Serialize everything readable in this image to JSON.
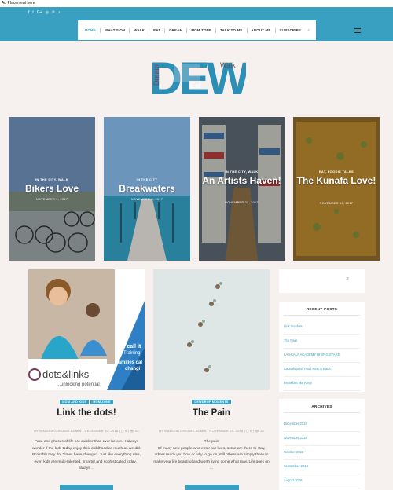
{
  "ad": {
    "text": "Ad Placement here"
  },
  "social_icons": [
    "facebook-icon",
    "twitter-icon",
    "google-plus-icon",
    "instagram-icon",
    "pinterest-icon",
    "blog-icon"
  ],
  "social_glyphs": [
    "f",
    "t",
    "G+",
    "◎",
    "℗",
    "♁"
  ],
  "nav": {
    "items": [
      "HOME",
      "WHAT'S ON",
      "WALK",
      "EAT",
      "DREAM",
      "MOM ZONE",
      "TALK TO ME",
      "ABOUT ME",
      "SUBSCRIBE"
    ],
    "search_glyph": "⌕"
  },
  "logo": {
    "big": "DEW",
    "dream": "Dream",
    "eat": "Eat",
    "walk": "Walk"
  },
  "featured": [
    {
      "category": "IN THE CITY, WALK",
      "title": "Bikers Love",
      "date": "NOVEMBER 9, 2017"
    },
    {
      "category": "IN THE CITY",
      "title": "Breakwaters",
      "date": "NOVEMBER 8, 2017"
    },
    {
      "category": "IN THE CITY, WALK",
      "title": "An Artists Haven!",
      "date": "NOVEMBER 21, 2017"
    },
    {
      "category": "EAT, FOODIE TALKS",
      "title": "The Kunafa Love!",
      "date": "NOVEMBER 13, 2017"
    }
  ],
  "posts": [
    {
      "tags": [
        "MOM AND KIDS",
        "MOM ZONE"
      ],
      "title": "Link the dots!",
      "meta": "BY WALKEATDREAMS ADMIN  |  DECEMBER 10, 2018  |  ◻ 0  |  👁 43",
      "excerpt": "Pace and phases of life are quicker than ever before.. I always wonder if the kids today enjoy their childhood as much as we did. Probably they do. Times have changed. Just like everything else, even kids are multi-talented, smarter and sophisticated today. I always ...",
      "image_text": {
        "callout1": "We call it",
        "callout2": "Training",
        "callout3": "Families cal",
        "callout4": "changi",
        "brand": "dots&links",
        "tagline": "...unlocking potential"
      }
    },
    {
      "tags": [
        "DEWDROP MOMENTS"
      ],
      "title": "The Pain",
      "meta": "BY WALKEATDREAMS ADMIN  |  NOVEMBER 25, 2018  |  ◻ 0  |  👁 18",
      "excerpt_lead": "The pain",
      "excerpt": "Of many new people who enter our lives, some are there to stay, others teach you how or why to go on, still others are simply there to make your life beautiful and worth living come what may. Life goes on ..."
    }
  ],
  "sidebar": {
    "search_glyph": "⌕",
    "recent_title": "RECENT POSTS",
    "recent": [
      "Link the dots!",
      "The Pain",
      "LA SCALA ACADEMY RISING STARS",
      "Capitals Best Food Fest is Back!",
      "Breakfast like King!"
    ],
    "archives_title": "ARCHIVES",
    "archives": [
      "December 2018",
      "November 2018",
      "October 2018",
      "September 2018",
      "August 2018"
    ]
  },
  "colors": {
    "accent": "#3aa0c1",
    "background": "#f6f1ee"
  }
}
